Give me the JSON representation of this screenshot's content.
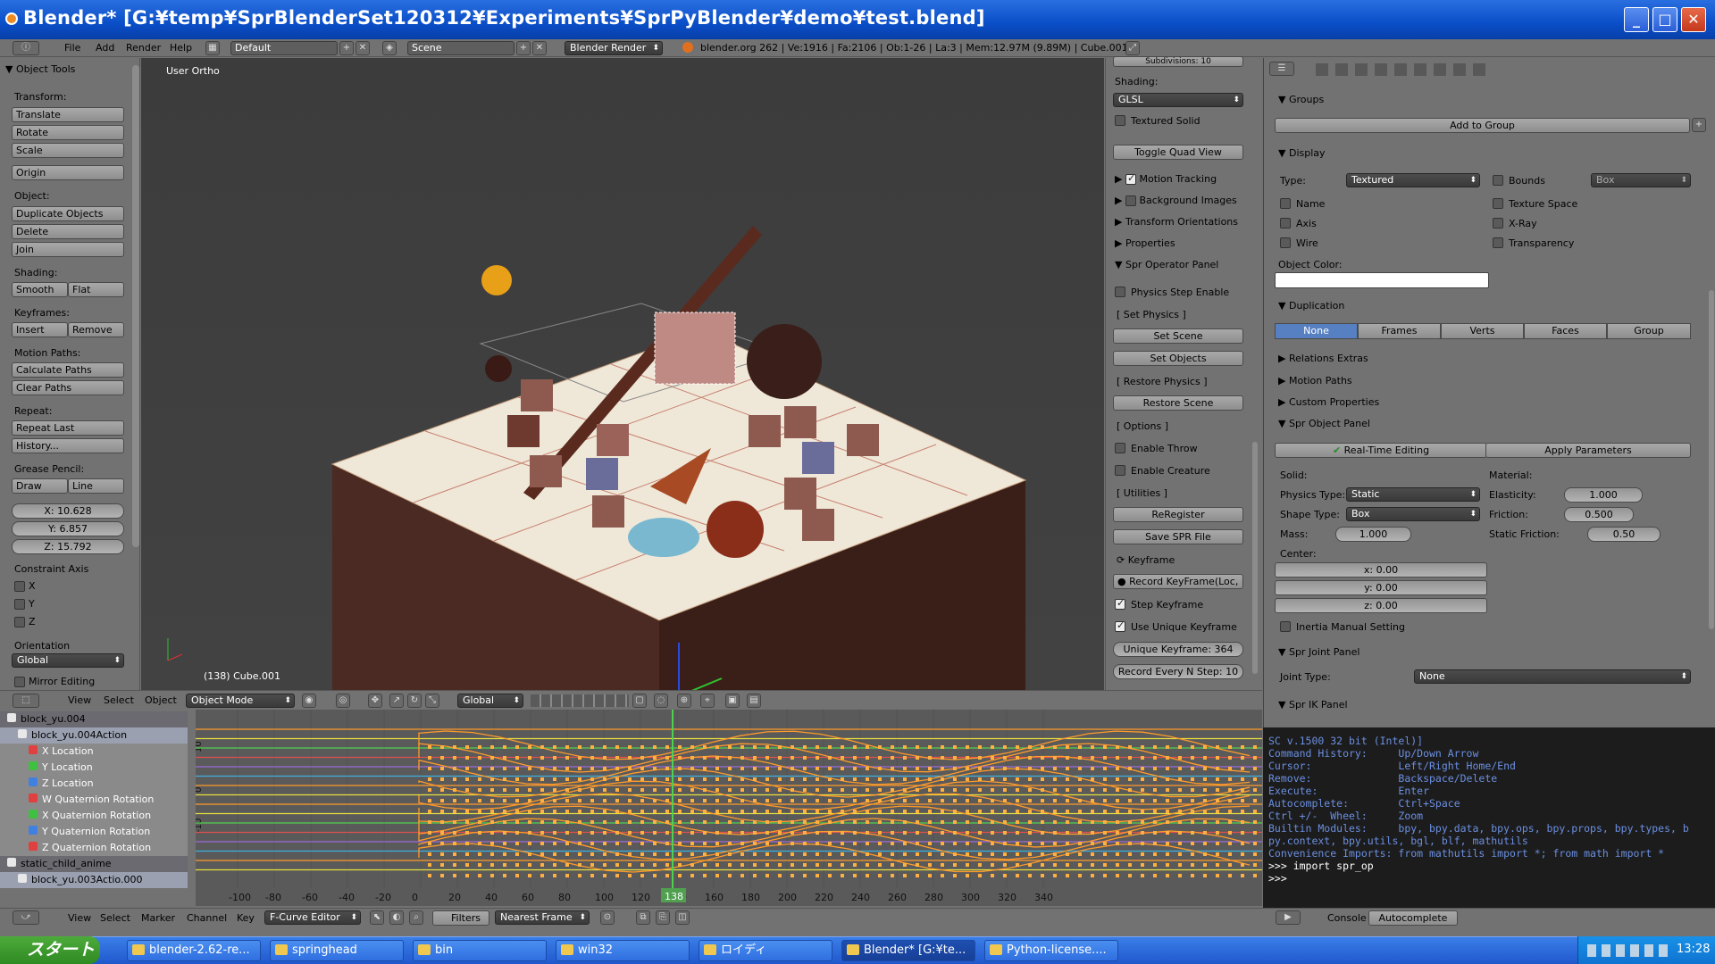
{
  "window": {
    "title": "Blender* [G:¥temp¥SprBlenderSet120312¥Experiments¥SprPyBlender¥demo¥test.blend]",
    "min": "_",
    "max": "□",
    "close": "✕"
  },
  "menubar": {
    "items": [
      "File",
      "Add",
      "Render",
      "Help"
    ],
    "layout": "Default",
    "scene": "Scene",
    "engine": "Blender Render",
    "stats": "blender.org 262 | Ve:1916 | Fa:2106 | Ob:1-26 | La:3 | Mem:12.97M (9.89M) | Cube.001"
  },
  "tools": {
    "header": "Object Tools",
    "transform_label": "Transform:",
    "translate": "Translate",
    "rotate": "Rotate",
    "scale": "Scale",
    "origin": "Origin",
    "object_label": "Object:",
    "duplicate": "Duplicate Objects",
    "delete": "Delete",
    "join": "Join",
    "shading_label": "Shading:",
    "smooth": "Smooth",
    "flat": "Flat",
    "keyframes_label": "Keyframes:",
    "insert": "Insert",
    "remove": "Remove",
    "motion_label": "Motion Paths:",
    "calc": "Calculate Paths",
    "clear": "Clear Paths",
    "repeat_label": "Repeat:",
    "repeat_last": "Repeat Last",
    "history": "History...",
    "grease_label": "Grease Pencil:",
    "draw": "Draw",
    "line": "Line",
    "x": "X: 10.628",
    "y": "Y: 6.857",
    "z": "Z: 15.792",
    "constraint_label": "Constraint Axis",
    "cx": "X",
    "cy": "Y",
    "cz": "Z",
    "orientation_label": "Orientation",
    "orientation": "Global",
    "mirror": "Mirror Editing"
  },
  "viewport": {
    "label": "User Ortho",
    "object": "(138) Cube.001"
  },
  "npanel": {
    "subdiv": "Subdivisions: 10",
    "shading_label": "Shading:",
    "shading": "GLSL",
    "textured_solid": "Textured Solid",
    "quad": "Toggle Quad View",
    "motion_tracking": "Motion Tracking",
    "bg_images": "Background Images",
    "transform_orient": "Transform Orientations",
    "properties": "Properties",
    "spr_op": "Spr Operator Panel",
    "physics_step": "Physics Step Enable",
    "set_physics": "[ Set Physics ]",
    "set_scene": "Set Scene",
    "set_objects": "Set Objects",
    "restore_physics": "[ Restore Physics ]",
    "restore_scene": "Restore Scene",
    "options": "[ Options ]",
    "enable_throw": "Enable Throw",
    "enable_creature": "Enable Creature",
    "utilities": "[ Utilities ]",
    "reregister": "ReRegister",
    "save_spr": "Save SPR File",
    "keyframe": "Keyframe",
    "record_kf": "Record KeyFrame(Loc, R",
    "step_kf": "Step Keyframe",
    "unique_kf": "Use Unique Keyframe",
    "unique_val": "Unique Keyframe: 364",
    "record_every": "Record Every N Step: 10"
  },
  "props": {
    "groups": "Groups",
    "add_group": "Add to Group",
    "display": "Display",
    "type_label": "Type:",
    "type": "Textured",
    "bounds": "Bounds",
    "box": "Box",
    "name": "Name",
    "texture_space": "Texture Space",
    "axis": "Axis",
    "xray": "X-Ray",
    "wire": "Wire",
    "transparency": "Transparency",
    "object_color": "Object Color:",
    "duplication": "Duplication",
    "dup_tabs": [
      "None",
      "Frames",
      "Verts",
      "Faces",
      "Group"
    ],
    "relations": "Relations Extras",
    "motion_paths": "Motion Paths",
    "custom_props": "Custom Properties",
    "spr_object": "Spr Object Panel",
    "realtime": "Real-Time Editing",
    "apply": "Apply Parameters",
    "solid": "Solid:",
    "material": "Material:",
    "physics_type_label": "Physics Type:",
    "physics_type": "Static",
    "elasticity_label": "Elasticity:",
    "elasticity": "1.000",
    "shape_type_label": "Shape Type:",
    "shape_type": "Box",
    "friction_label": "Friction:",
    "friction": "0.500",
    "mass_label": "Mass:",
    "mass": "1.000",
    "static_friction_label": "Static Friction:",
    "static_friction": "0.50",
    "center": "Center:",
    "cx": "x: 0.00",
    "cy": "y: 0.00",
    "cz": "z: 0.00",
    "inertia": "Inertia Manual Setting",
    "spr_joint": "Spr Joint Panel",
    "joint_type_label": "Joint Type:",
    "joint_type": "None",
    "spr_ik": "Spr IK Panel"
  },
  "vpheader": {
    "view": "View",
    "select": "Select",
    "object": "Object",
    "mode": "Object Mode",
    "orient": "Global"
  },
  "channels": [
    {
      "name": "block_yu.004",
      "level": 0,
      "color": "#e8e8e8"
    },
    {
      "name": "block_yu.004Action",
      "level": 1,
      "color": "#e8e8e8"
    },
    {
      "name": "X Location",
      "level": 2,
      "color": "#e04040"
    },
    {
      "name": "Y Location",
      "level": 2,
      "color": "#40c040"
    },
    {
      "name": "Z Location",
      "level": 2,
      "color": "#4080e0"
    },
    {
      "name": "W Quaternion Rotation",
      "level": 2,
      "color": "#e04040"
    },
    {
      "name": "X Quaternion Rotation",
      "level": 2,
      "color": "#40c040"
    },
    {
      "name": "Y Quaternion Rotation",
      "level": 2,
      "color": "#4080e0"
    },
    {
      "name": "Z Quaternion Rotation",
      "level": 2,
      "color": "#e04040"
    },
    {
      "name": "static_child_anime",
      "level": 0,
      "color": "#e8e8e8"
    },
    {
      "name": "block_yu.003Actio.000",
      "level": 1,
      "color": "#e8e8e8"
    }
  ],
  "graph": {
    "current_frame": "138",
    "ticks": [
      "-100",
      "-80",
      "-60",
      "-40",
      "-20",
      "0",
      "20",
      "40",
      "60",
      "80",
      "100",
      "120",
      "140",
      "160",
      "180",
      "200",
      "220",
      "240",
      "260",
      "280",
      "300",
      "320",
      "340"
    ],
    "yticks": [
      "10",
      "0",
      "-10"
    ]
  },
  "console": {
    "lines": [
      "SC v.1500 32 bit (Intel)]",
      "",
      "Command History:     Up/Down Arrow",
      "Cursor:              Left/Right Home/End",
      "Remove:              Backspace/Delete",
      "Execute:             Enter",
      "Autocomplete:        Ctrl+Space",
      "Ctrl +/-  Wheel:     Zoom",
      "Builtin Modules:     bpy, bpy.data, bpy.ops, bpy.props, bpy.types, b",
      "py.context, bpy.utils, bgl, blf, mathutils",
      "Convenience Imports: from mathutils import *; from math import *",
      "",
      "",
      ">>> import spr_op",
      ">>> "
    ]
  },
  "gfooter": {
    "view": "View",
    "select": "Select",
    "marker": "Marker",
    "channel": "Channel",
    "key": "Key",
    "editor": "F-Curve Editor",
    "filters": "Filters",
    "snap": "Nearest Frame",
    "console": "Console",
    "autocomplete": "Autocomplete"
  },
  "taskbar": {
    "start": "スタート",
    "tasks": [
      "blender-2.62-re...",
      "springhead",
      "bin",
      "win32",
      "ロイディ",
      "Blender* [G:¥te...",
      "Python-license...."
    ],
    "clock": "13:28"
  }
}
